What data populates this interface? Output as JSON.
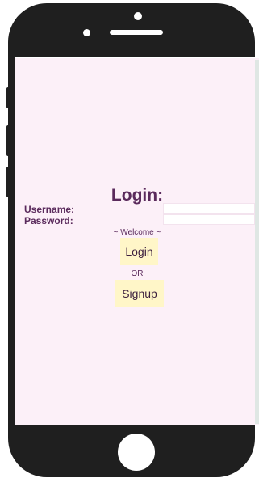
{
  "screen": {
    "title": "Login:",
    "username_label": "Username:",
    "password_label": "Password:",
    "username_value": "",
    "password_value": "",
    "welcome_text": "~ Welcome ~",
    "login_button": "Login",
    "or_text": "OR",
    "signup_button": "Signup"
  },
  "colors": {
    "screen_background": "#fcf0f8",
    "text_accent": "#5a2a5c",
    "button_background": "#fff6c8",
    "phone_body": "#1f1f1f"
  }
}
